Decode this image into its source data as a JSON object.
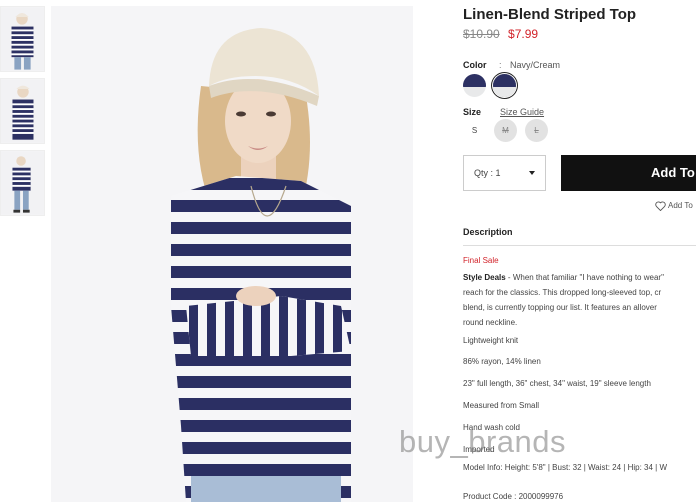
{
  "product": {
    "title": "Linen-Blend Striped Top",
    "price_original": "$10.90",
    "price_sale": "$7.99"
  },
  "color": {
    "label": "Color",
    "separator": ":",
    "value": "Navy/Cream",
    "swatches": [
      {
        "name": "Navy/Cream",
        "top": "#2d3163",
        "bottom": "#e8e9ea"
      },
      {
        "name": "Navy/Cream",
        "top": "#2d3163",
        "bottom": "#e8e9ea"
      }
    ]
  },
  "size": {
    "label": "Size",
    "guide_label": "Size Guide",
    "options": [
      "S",
      "M",
      "L"
    ]
  },
  "qty_label": "Qty : 1",
  "add_button_label": "Add To",
  "wishlist_label": "Add To",
  "description": {
    "heading": "Description",
    "final_sale": "Final Sale",
    "lead_bold": "Style Deals",
    "line1": " - When that familiar \"I have nothing to wear\"",
    "line2": "reach for the classics. This dropped long-sleeved top, cr",
    "line3": "blend, is currently topping our list. It features an allover",
    "line4": "round neckline.",
    "details": [
      "Lightweight knit",
      "86% rayon, 14% linen",
      "23\" full length, 36\" chest, 34\" waist, 19\" sleeve length",
      "Measured from Small",
      "Hand wash cold",
      "Imported",
      "Model Info: Height: 5'8\" | Bust: 32 | Waist: 24 | Hip: 34 | W",
      "Product Code : 2000099976"
    ]
  },
  "watermark": "buy_brands",
  "colors": {
    "sale": "#d2232a",
    "button": "#111111",
    "navy": "#2d3163"
  }
}
